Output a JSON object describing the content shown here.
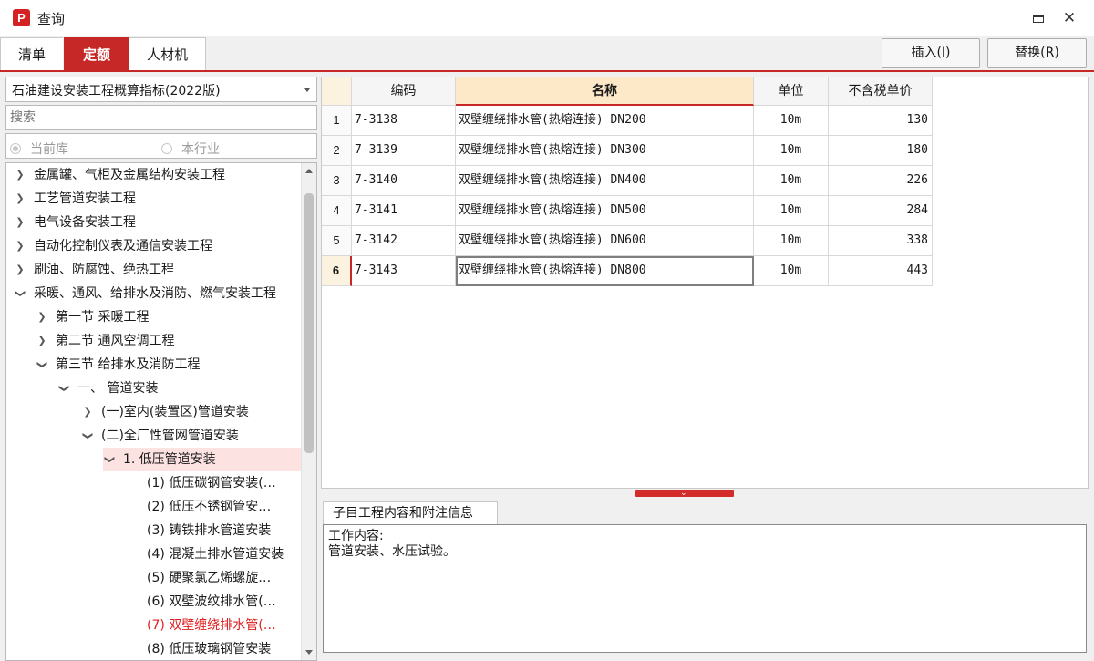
{
  "window": {
    "title": "查询",
    "icon_text": "P",
    "maximize_icon": "maximize-icon",
    "close_icon": "close-icon",
    "close_glyph": "✕"
  },
  "tabs": [
    {
      "label": "清单"
    },
    {
      "label": "定额"
    },
    {
      "label": "人材机"
    }
  ],
  "toolbar": {
    "insert_label": "插入(I)",
    "replace_label": "替换(R)"
  },
  "library": {
    "selected": "石油建设安装工程概算指标(2022版)"
  },
  "search": {
    "placeholder": "搜索"
  },
  "scope": {
    "current": "当前库",
    "industry": "本行业",
    "selected": "当前库"
  },
  "tree": [
    {
      "label": "金属罐、气柜及金属结构安装工程",
      "expanded": false
    },
    {
      "label": "工艺管道安装工程",
      "expanded": false
    },
    {
      "label": "电气设备安装工程",
      "expanded": false
    },
    {
      "label": "自动化控制仪表及通信安装工程",
      "expanded": false
    },
    {
      "label": "刷油、防腐蚀、绝热工程",
      "expanded": false
    },
    {
      "label": "采暖、通风、给排水及消防、燃气安装工程",
      "expanded": true
    },
    {
      "label": "第一节 采暖工程",
      "expanded": false
    },
    {
      "label": "第二节 通风空调工程",
      "expanded": false
    },
    {
      "label": "第三节 给排水及消防工程",
      "expanded": true
    },
    {
      "label": "一、 管道安装",
      "expanded": true
    },
    {
      "label": "(一)室内(装置区)管道安装",
      "expanded": false
    },
    {
      "label": "(二)全厂性管网管道安装",
      "expanded": true
    },
    {
      "label": "1. 低压管道安装",
      "expanded": true,
      "selected": true
    },
    {
      "label": "(1) 低压碳钢管安装(…"
    },
    {
      "label": "(2) 低压不锈钢管安…"
    },
    {
      "label": "(3) 铸铁排水管道安装"
    },
    {
      "label": "(4) 混凝土排水管道安装"
    },
    {
      "label": "(5) 硬聚氯乙烯螺旋…"
    },
    {
      "label": "(6) 双壁波纹排水管(…"
    },
    {
      "label": "(7) 双壁缠绕排水管(…",
      "highlighted": true
    },
    {
      "label": "(8) 低压玻璃钢管安装"
    }
  ],
  "grid": {
    "columns": {
      "code": "编码",
      "name": "名称",
      "unit": "单位",
      "price": "不含税单价"
    },
    "rows": [
      {
        "no": "1",
        "code": "7-3138",
        "name": "双壁缠绕排水管(热熔连接) DN200",
        "unit": "10m",
        "price": "130"
      },
      {
        "no": "2",
        "code": "7-3139",
        "name": "双壁缠绕排水管(热熔连接) DN300",
        "unit": "10m",
        "price": "180"
      },
      {
        "no": "3",
        "code": "7-3140",
        "name": "双壁缠绕排水管(热熔连接) DN400",
        "unit": "10m",
        "price": "226"
      },
      {
        "no": "4",
        "code": "7-3141",
        "name": "双壁缠绕排水管(热熔连接) DN500",
        "unit": "10m",
        "price": "284"
      },
      {
        "no": "5",
        "code": "7-3142",
        "name": "双壁缠绕排水管(热熔连接) DN600",
        "unit": "10m",
        "price": "338"
      },
      {
        "no": "6",
        "code": "7-3143",
        "name": "双壁缠绕排水管(热熔连接) DN800",
        "unit": "10m",
        "price": "443"
      }
    ],
    "current_row": "6"
  },
  "splitter": {
    "glyph": "⌄"
  },
  "info": {
    "tab_label": "子目工程内容和附注信息",
    "line1": "工作内容:",
    "line2": "管道安装、水压试验。"
  },
  "colors": {
    "accent": "#c62828",
    "selection": "#fde2e2",
    "highlight_text": "#e02020"
  }
}
